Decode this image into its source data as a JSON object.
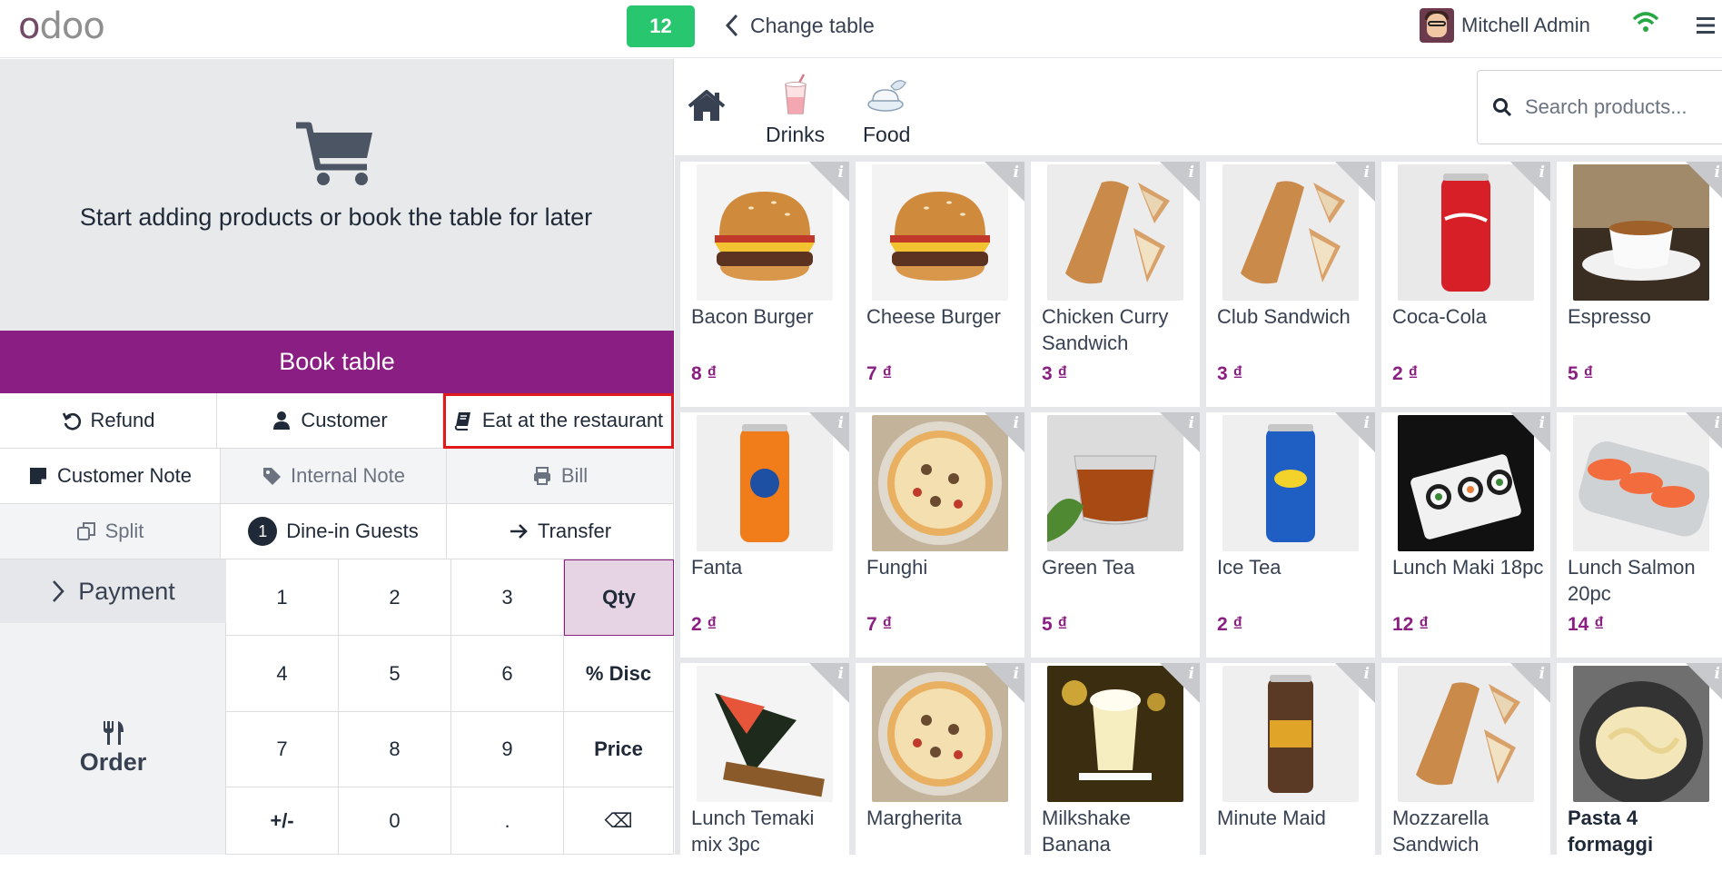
{
  "header": {
    "logo": {
      "first": "o",
      "rest": "doo"
    },
    "table_number": "12",
    "change_table_label": "Change table",
    "user_name": "Mitchell Admin"
  },
  "order": {
    "empty_message": "Start adding products or book the table for later",
    "book_table_label": "Book table"
  },
  "controls": {
    "refund": "Refund",
    "customer": "Customer",
    "eat_at_restaurant": "Eat at the restaurant",
    "customer_note": "Customer Note",
    "internal_note": "Internal Note",
    "bill": "Bill",
    "split": "Split",
    "guests_count": "1",
    "dine_in_guests": "Dine-in Guests",
    "transfer": "Transfer"
  },
  "actions": {
    "payment": "Payment",
    "order": "Order"
  },
  "numpad": {
    "k1": "1",
    "k2": "2",
    "k3": "3",
    "qty": "Qty",
    "k4": "4",
    "k5": "5",
    "k6": "6",
    "disc": "% Disc",
    "k7": "7",
    "k8": "8",
    "k9": "9",
    "price": "Price",
    "plusminus": "+/-",
    "k0": "0",
    "dot": ".",
    "backspace": "⌫"
  },
  "categories": {
    "drinks": "Drinks",
    "food": "Food"
  },
  "search": {
    "placeholder": "Search products..."
  },
  "colors": {
    "brand": "#8a1e82",
    "table_badge": "#28c76f",
    "highlight": "#e01a1a"
  },
  "products": [
    {
      "name": "Bacon Burger",
      "price": "8 ₫",
      "icon": "burger"
    },
    {
      "name": "Cheese Burger",
      "price": "7 ₫",
      "icon": "burger"
    },
    {
      "name": "Chicken Curry Sandwich",
      "price": "3 ₫",
      "icon": "sandwich"
    },
    {
      "name": "Club Sandwich",
      "price": "3 ₫",
      "icon": "sandwich"
    },
    {
      "name": "Coca-Cola",
      "price": "2 ₫",
      "icon": "can-red"
    },
    {
      "name": "Espresso",
      "price": "5 ₫",
      "icon": "coffee"
    },
    {
      "name": "Fanta",
      "price": "2 ₫",
      "icon": "can-orange"
    },
    {
      "name": "Funghi",
      "price": "7 ₫",
      "icon": "pizza"
    },
    {
      "name": "Green Tea",
      "price": "5 ₫",
      "icon": "tea"
    },
    {
      "name": "Ice Tea",
      "price": "2 ₫",
      "icon": "can-blue"
    },
    {
      "name": "Lunch Maki 18pc",
      "price": "12 ₫",
      "icon": "maki"
    },
    {
      "name": "Lunch Salmon 20pc",
      "price": "14 ₫",
      "icon": "salmon"
    },
    {
      "name": "Lunch Temaki mix 3pc",
      "price": "",
      "icon": "temaki"
    },
    {
      "name": "Margherita",
      "price": "",
      "icon": "pizza"
    },
    {
      "name": "Milkshake Banana",
      "price": "",
      "icon": "milkshake"
    },
    {
      "name": "Minute Maid",
      "price": "",
      "icon": "can-dark"
    },
    {
      "name": "Mozzarella Sandwich",
      "price": "",
      "icon": "sandwich"
    },
    {
      "name": "Pasta 4 formaggi",
      "price": "",
      "icon": "pasta"
    }
  ]
}
